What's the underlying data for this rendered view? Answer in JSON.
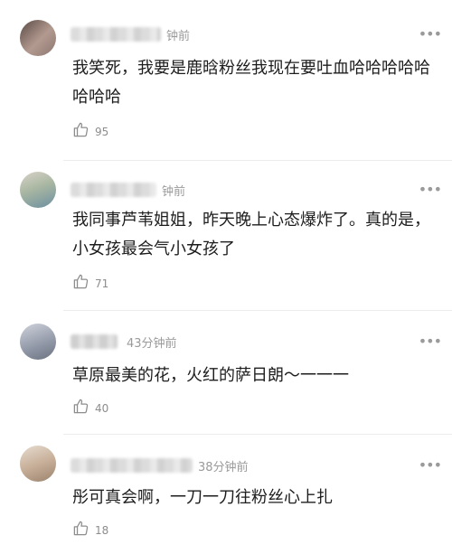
{
  "comments": [
    {
      "time": "钟前",
      "text": "我笑死，我要是鹿晗粉丝我现在要吐血哈哈哈哈哈哈哈哈",
      "likes": "95"
    },
    {
      "time": "钟前",
      "text": "我同事芦苇姐姐，昨天晚上心态爆炸了。真的是，小女孩最会气小女孩了",
      "likes": "71"
    },
    {
      "time": "43分钟前",
      "text": "草原最美的花，火红的萨日朗～一一一",
      "likes": "40"
    },
    {
      "time": "38分钟前",
      "text": "彤可真会啊，一刀一刀往粉丝心上扎",
      "likes": "18"
    }
  ],
  "icons": {
    "like": "thumbs-up-icon",
    "more": "more-options-icon"
  },
  "colors": {
    "time": "#9a9a9a",
    "text": "#1d1d1d",
    "divider": "#ececec"
  }
}
